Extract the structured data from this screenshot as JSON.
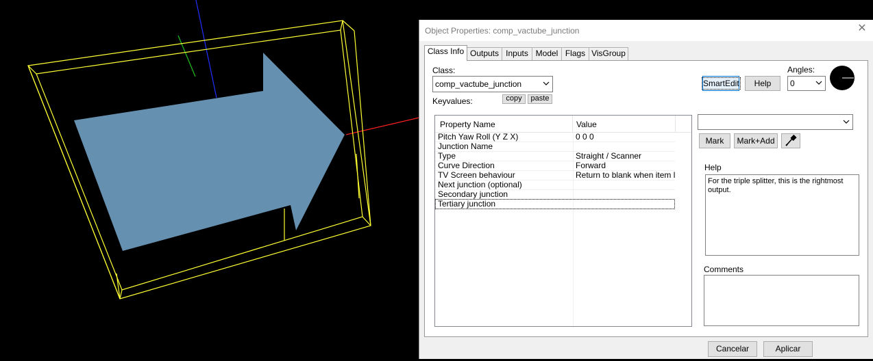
{
  "dialog": {
    "title": "Object Properties: comp_vactube_junction",
    "tabs": [
      {
        "label": "Class Info"
      },
      {
        "label": "Outputs"
      },
      {
        "label": "Inputs"
      },
      {
        "label": "Model"
      },
      {
        "label": "Flags"
      },
      {
        "label": "VisGroup"
      }
    ],
    "class_label": "Class:",
    "class_value": "comp_vactube_junction",
    "keyvalues_label": "Keyvalues:",
    "copy_label": "copy",
    "paste_label": "paste",
    "smartedit_label": "SmartEdit",
    "help_button_label": "Help",
    "angles_label": "Angles:",
    "angles_value": "0",
    "grid": {
      "headers": [
        "Property Name",
        "Value"
      ],
      "rows": [
        {
          "key": "Pitch Yaw Roll (Y Z X)",
          "value": "0 0 0"
        },
        {
          "key": "Junction Name",
          "value": ""
        },
        {
          "key": "Type",
          "value": "Straight / Scanner"
        },
        {
          "key": "Curve Direction",
          "value": "Forward"
        },
        {
          "key": "TV Screen behaviour",
          "value": "Return to blank when item leav"
        },
        {
          "key": "Next junction (optional)",
          "value": ""
        },
        {
          "key": "Secondary junction",
          "value": ""
        },
        {
          "key": "Tertiary junction",
          "value": ""
        }
      ]
    },
    "value_combo": "",
    "mark_label": "Mark",
    "markadd_label": "Mark+Add",
    "help_heading": "Help",
    "help_text": "For the triple splitter, this is the rightmost output.",
    "comments_heading": "Comments",
    "comments_text": "",
    "cancel_label": "Cancelar",
    "apply_label": "Aplicar"
  },
  "viewport": {
    "box_color": "#ffff33",
    "arrow_color": "#6690b0",
    "axis_x_color": "#ff2020",
    "axis_y_color": "#20c020",
    "axis_z_color": "#2030ff"
  }
}
